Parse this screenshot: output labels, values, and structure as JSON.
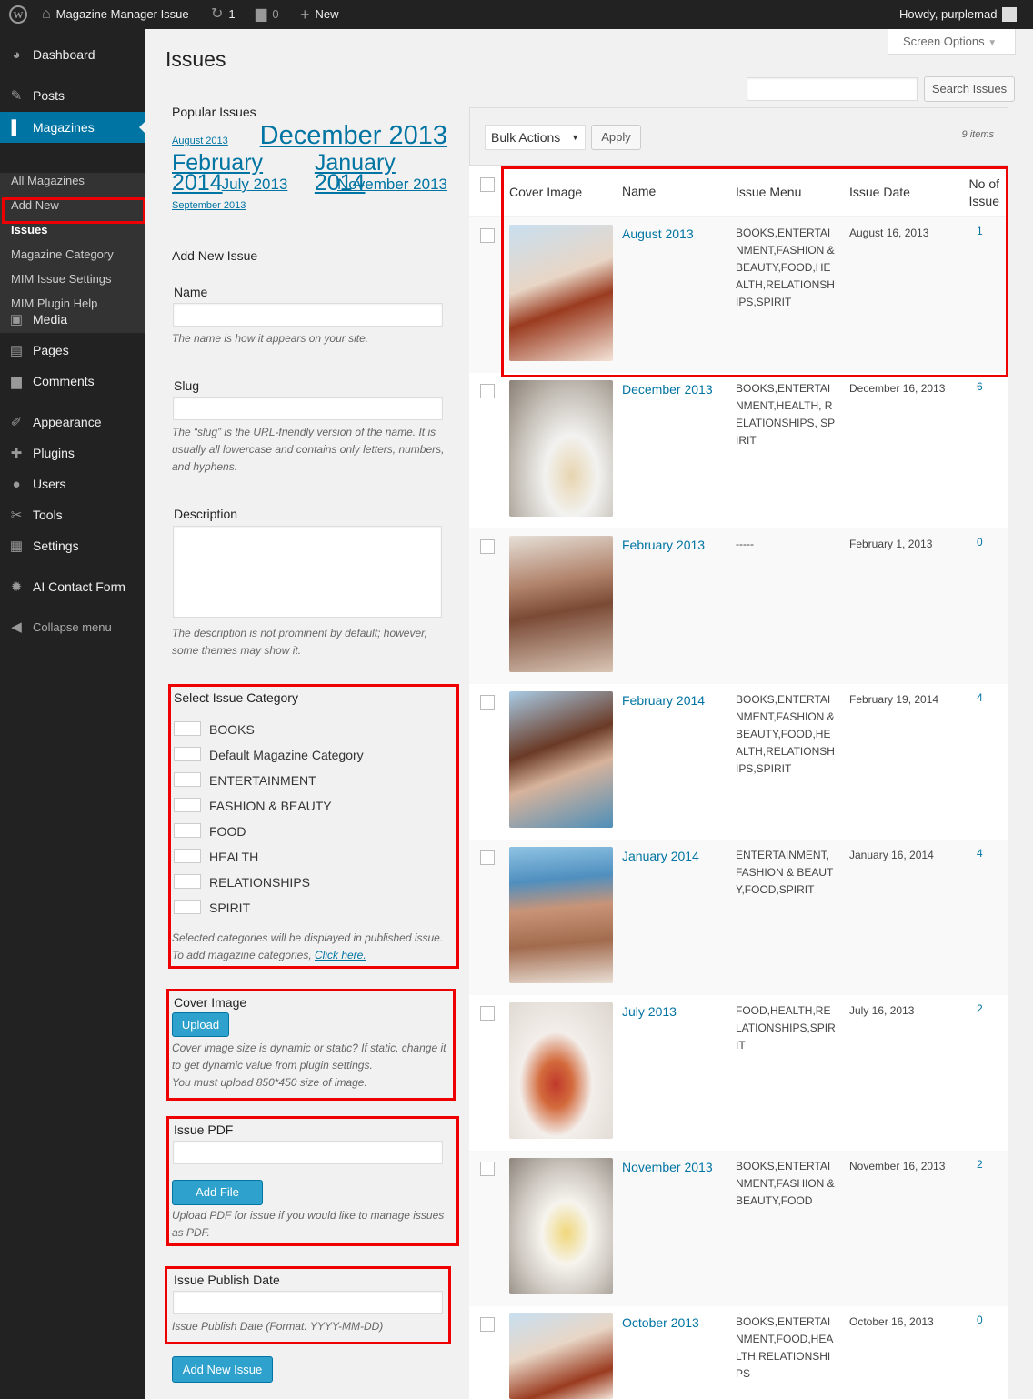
{
  "adminbar": {
    "site": "Magazine Manager Issue",
    "updates": "1",
    "comments": "0",
    "new": "New",
    "howdy": "Howdy, purplemad"
  },
  "sidebar": {
    "items": [
      {
        "label": "Dashboard",
        "icon": "dashboard-icon"
      },
      {
        "label": "Posts",
        "icon": "pin-icon"
      },
      {
        "label": "Magazines",
        "icon": "book-icon"
      },
      {
        "label": "Media",
        "icon": "media-icon"
      },
      {
        "label": "Pages",
        "icon": "pages-icon"
      },
      {
        "label": "Comments",
        "icon": "comment-icon"
      },
      {
        "label": "Appearance",
        "icon": "brush-icon"
      },
      {
        "label": "Plugins",
        "icon": "plug-icon"
      },
      {
        "label": "Users",
        "icon": "user-icon"
      },
      {
        "label": "Tools",
        "icon": "wrench-icon"
      },
      {
        "label": "Settings",
        "icon": "settings-icon"
      },
      {
        "label": "AI Contact Form",
        "icon": "gear-icon"
      }
    ],
    "submenu": [
      "All Magazines",
      "Add New",
      "Issues",
      "Magazine Category",
      "MIM Issue Settings",
      "MIM Plugin Help"
    ],
    "collapse": "Collapse menu"
  },
  "page": {
    "title": "Issues",
    "screen_options": "Screen Options"
  },
  "popular": {
    "title": "Popular Issues",
    "tags": [
      "August 2013",
      "December 2013",
      "February 2014",
      "January 2014",
      "July 2013",
      "November 2013",
      "September 2013"
    ]
  },
  "form": {
    "heading": "Add New Issue",
    "name_label": "Name",
    "name_hint": "The name is how it appears on your site.",
    "slug_label": "Slug",
    "slug_hint": "The “slug” is the URL-friendly version of the name. It is usually all lowercase and contains only letters, numbers, and hyphens.",
    "desc_label": "Description",
    "desc_hint": "The description is not prominent by default; however, some themes may show it.",
    "cat_label": "Select  Issue Category",
    "categories": [
      "BOOKS",
      "Default Magazine Category",
      "ENTERTAINMENT",
      "FASHION & BEAUTY",
      "FOOD",
      "HEALTH",
      "RELATIONSHIPS",
      "SPIRIT"
    ],
    "cat_hint": "Selected categories will be displayed in published issue.",
    "cat_hint2": "To add magazine categories,",
    "cat_link": "Click here.",
    "cover_label": "Cover Image",
    "upload_btn": "Upload",
    "cover_hint": "Cover image size is dynamic or static? If static, change it to get dynamic value from plugin settings.",
    "cover_hint2": "You must upload 850*450 size of image.",
    "pdf_label": "Issue PDF",
    "addfile_btn": "Add File",
    "pdf_hint": "Upload PDF for issue if you would like to manage issues as PDF.",
    "date_label": "Issue Publish Date",
    "date_hint": "Issue Publish Date (Format: YYYY-MM-DD)",
    "submit_btn": "Add New Issue"
  },
  "table": {
    "search_btn": "Search Issues",
    "bulk": "Bulk Actions",
    "apply": "Apply",
    "count": "9 items",
    "headers": {
      "cover": "Cover Image",
      "name": "Name",
      "menu": "Issue Menu",
      "date": "Issue Date",
      "no": "No of Issue"
    },
    "rows": [
      {
        "name": "August 2013",
        "menu": "BOOKS,ENTERTAINMENT,FASHION & BEAUTY,FOOD,HEALTH,RELATIONSHIPS,SPIRIT",
        "date": "August 16, 2013",
        "no": "1"
      },
      {
        "name": "December 2013",
        "menu": "BOOKS,ENTERTAINMENT,HEALTH, RELATIONSHIPS, SPIRIT",
        "date": "December 16, 2013",
        "no": "6"
      },
      {
        "name": "February 2013",
        "menu": "-----",
        "date": "February 1, 2013",
        "no": "0"
      },
      {
        "name": "February 2014",
        "menu": "BOOKS,ENTERTAINMENT,FASHION & BEAUTY,FOOD,HEALTH,RELATIONSHIPS,SPIRIT",
        "date": "February 19, 2014",
        "no": "4"
      },
      {
        "name": "January 2014",
        "menu": "ENTERTAINMENT,FASHION & BEAUTY,FOOD,SPIRIT",
        "date": "January 16, 2014",
        "no": "4"
      },
      {
        "name": "July 2013",
        "menu": "FOOD,HEALTH,RELATIONSHIPS,SPIRIT",
        "date": "July 16, 2013",
        "no": "2"
      },
      {
        "name": "November 2013",
        "menu": "BOOKS,ENTERTAINMENT,FASHION & BEAUTY,FOOD",
        "date": "November 16, 2013",
        "no": "2"
      },
      {
        "name": "October 2013",
        "menu": "BOOKS,ENTERTAINMENT,FOOD,HEALTH,RELATIONSHIPS",
        "date": "October 16, 2013",
        "no": "0"
      }
    ]
  }
}
